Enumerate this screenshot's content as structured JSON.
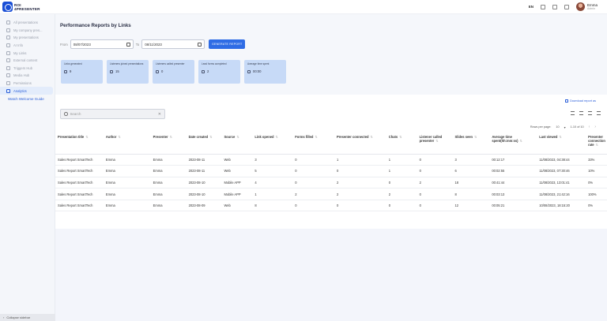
{
  "brand": {
    "line1": "ROI",
    "line2": "4PRESENTER"
  },
  "topbar": {
    "lang": "EN",
    "user_name": "Emma",
    "user_role": "Admin"
  },
  "sidebar": {
    "items": [
      {
        "label": "All presentations",
        "icon": "grid-icon"
      },
      {
        "label": "My company pres...",
        "icon": "building-icon"
      },
      {
        "label": "My presentations",
        "icon": "folder-icon"
      },
      {
        "label": "AI Info",
        "icon": "info-icon"
      },
      {
        "label": "My Links",
        "icon": "link-icon"
      },
      {
        "label": "External content",
        "icon": "external-icon"
      },
      {
        "label": "Triggers Hub",
        "icon": "trigger-icon"
      },
      {
        "label": "Media Hub",
        "icon": "media-icon"
      },
      {
        "label": "Permissions",
        "icon": "lock-icon"
      },
      {
        "label": "Analytics",
        "icon": "chart-icon",
        "active": true
      }
    ],
    "guide": "Watch Welcome Guide",
    "collapse": "Collapse sidebar"
  },
  "page": {
    "title": "Performance Reports by Links",
    "from_label": "From",
    "from_value": "08/07/2023",
    "to_label": "To",
    "to_value": "08/11/2023",
    "generate": "GENERATE REPORT"
  },
  "cards": [
    {
      "label": "Links generated",
      "value": "9"
    },
    {
      "label": "Listeners joined presentations",
      "value": "15"
    },
    {
      "label": "Listeners called presenter",
      "value": "0"
    },
    {
      "label": "Lead forms completed",
      "value": "2"
    },
    {
      "label": "Average time spent",
      "value": "00:00"
    }
  ],
  "report": {
    "download": "Download report as",
    "search_placeholder": "Search",
    "rows_per_page_label": "Rows per page:",
    "rows_per_page": "10",
    "range": "1-10 of 10"
  },
  "table": {
    "headers": [
      "Presentation title",
      "Author",
      "Presenter",
      "Date created",
      "Source",
      "Link opened",
      "Forms filled",
      "Presenter connected",
      "Chats",
      "Listener called presenter",
      "Slides seen",
      "Average time spent(hh:mm:ss)",
      "Last viewed",
      "Presenter connection rate"
    ],
    "rows": [
      [
        "Sales Report SmartTech",
        "Emma",
        "Emma",
        "2023-08-11",
        "Web",
        "3",
        "0",
        "1",
        "1",
        "0",
        "3",
        "00:12:17",
        "11/08/2023, 04:38:44",
        "33%"
      ],
      [
        "Sales Report SmartTech",
        "Emma",
        "Emma",
        "2023-08-11",
        "Web",
        "5",
        "0",
        "0",
        "1",
        "0",
        "6",
        "00:02:55",
        "11/08/2023, 07:30:46",
        "10%"
      ],
      [
        "Sales Report SmartTech",
        "Emma",
        "Emma",
        "2023-08-10",
        "Mobile APP",
        "4",
        "0",
        "2",
        "0",
        "2",
        "18",
        "00:41:44",
        "11/08/2023, 13:01:41",
        "0%"
      ],
      [
        "Sales Report SmartTech",
        "Emma",
        "Emma",
        "2023-08-10",
        "Mobile APP",
        "1",
        "2",
        "2",
        "2",
        "0",
        "8",
        "00:03:13",
        "11/08/2023, 21:42:16",
        "100%"
      ],
      [
        "Sales Report SmartTech",
        "Emma",
        "Emma",
        "2023-08-09",
        "Web",
        "8",
        "0",
        "0",
        "0",
        "0",
        "12",
        "00:05:21",
        "10/08/2023, 18:15:20",
        "0%"
      ]
    ]
  }
}
